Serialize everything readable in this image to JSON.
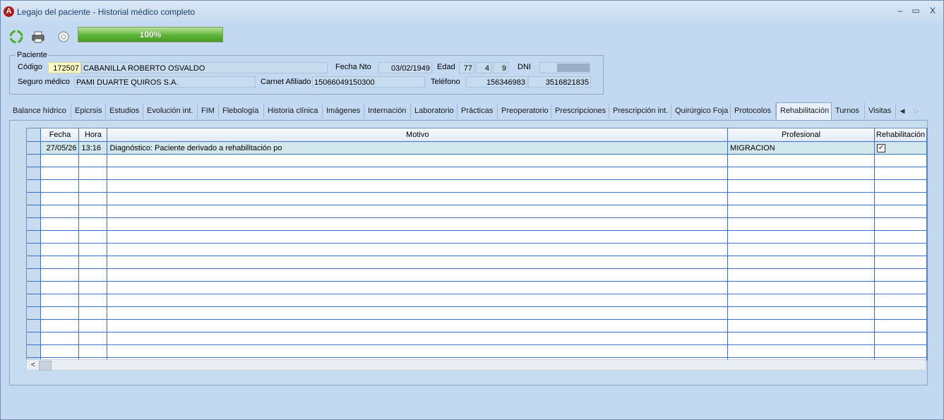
{
  "window": {
    "title": "Legajo del paciente - Historial médico completo",
    "app_icon_letter": "A",
    "minimize": "–",
    "maximize": "▭",
    "close": "X"
  },
  "toolbar": {
    "refresh_icon": "refresh-icon",
    "print_icon": "printer-icon",
    "emblem_icon": "emblem-icon",
    "progress": {
      "value": 1.0,
      "text": "100%"
    }
  },
  "patient": {
    "group_title": "Paciente",
    "codigo_label": "Código",
    "codigo": "172507",
    "nombre": "CABANILLA ROBERTO OSVALDO",
    "fecha_nto_label": "Fecha Nto",
    "fecha_nto": "03/02/1949",
    "edad_label": "Edad",
    "edad_anios": "77",
    "edad_meses": "4",
    "edad_dias": "9",
    "dni_label": "DNI",
    "dni": "",
    "seguro_label": "Seguro médico",
    "seguro": "PAMI DUARTE QUIROS S.A.",
    "carnet_label": "Carnet Afiliado",
    "carnet": "15066049150300",
    "telefono_label": "Teléfono",
    "telefono1": "156346983",
    "telefono2": "3516821835"
  },
  "tabs": [
    {
      "label": "Balance hídrico"
    },
    {
      "label": "Epicrsis"
    },
    {
      "label": "Estudios"
    },
    {
      "label": "Evolución int."
    },
    {
      "label": "FIM"
    },
    {
      "label": "Flebología"
    },
    {
      "label": "Historia clínica"
    },
    {
      "label": "Imágenes"
    },
    {
      "label": "Internación"
    },
    {
      "label": "Laboratorio"
    },
    {
      "label": "Prácticas"
    },
    {
      "label": "Preoperatorio"
    },
    {
      "label": "Prescripciones"
    },
    {
      "label": "Prescripción int."
    },
    {
      "label": "Quirúrgico Foja"
    },
    {
      "label": "Protocolos"
    },
    {
      "label": "Rehabilitación"
    },
    {
      "label": "Turnos"
    },
    {
      "label": "Visitas"
    }
  ],
  "active_tab": "Rehabilitación",
  "grid": {
    "columns": [
      "Fecha",
      "Hora",
      "Motivo",
      "Profesional",
      "Rehabilitación"
    ],
    "rows": [
      {
        "fecha": "27/05/26",
        "hora": "13:16",
        "motivo": "Diagnóstico: Paciente derivado a rehabilitación po",
        "profesional": "MIGRACION",
        "rehabilitacion": true
      }
    ]
  }
}
